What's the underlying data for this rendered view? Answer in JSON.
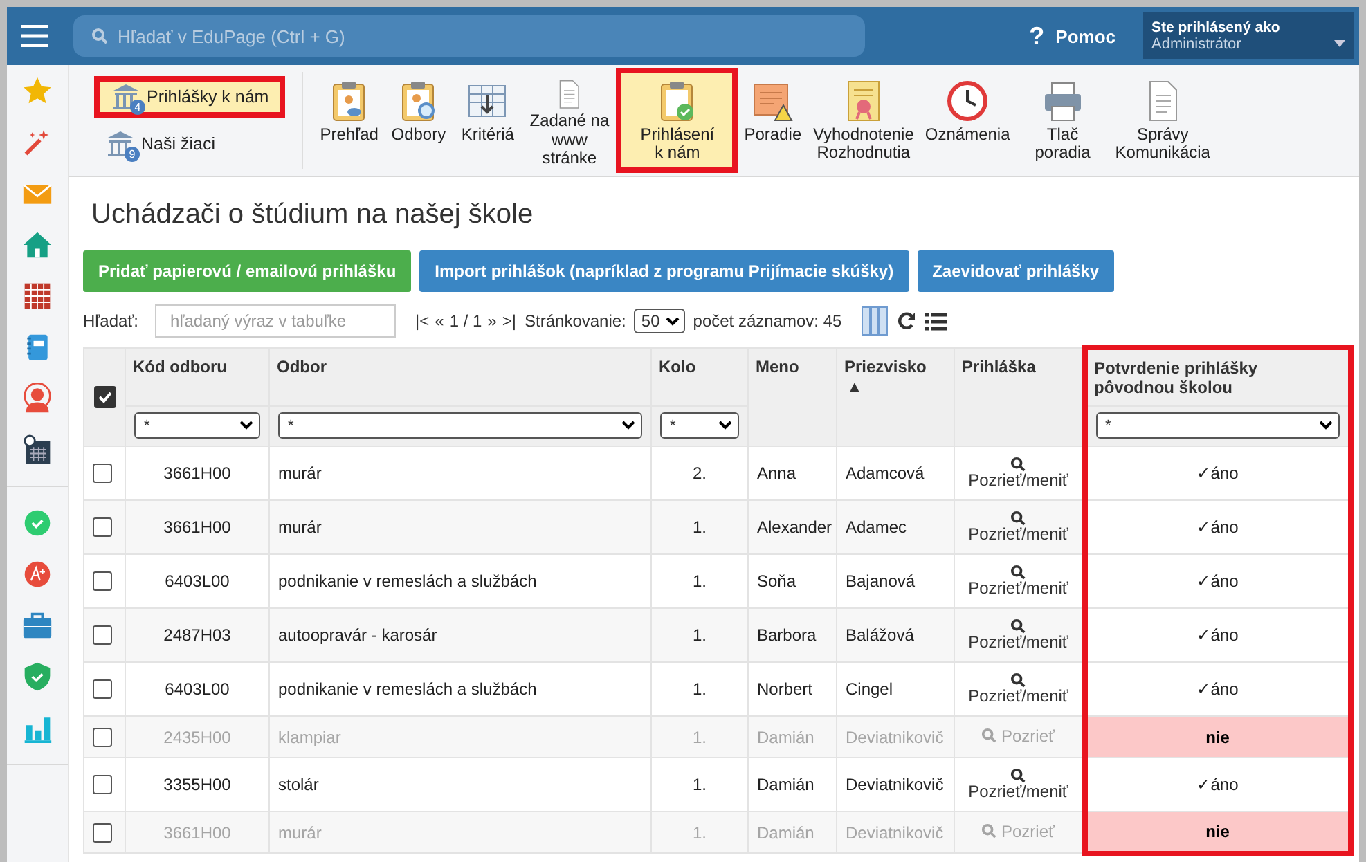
{
  "topbar": {
    "search": {
      "placeholder": "Hľadať v EduPage (Ctrl + G)"
    },
    "help": {
      "icon": "?",
      "label": "Pomoc"
    },
    "user": {
      "caption": "Ste prihlásený ako",
      "name": "Administrátor"
    }
  },
  "toolbar": {
    "left": [
      {
        "label": "Prihlášky k nám",
        "badge": "4",
        "selected": true,
        "highlighted": true
      },
      {
        "label": "Naši žiaci",
        "badge": "9",
        "selected": false,
        "highlighted": false
      }
    ],
    "tools": [
      {
        "label": "Prehľad",
        "selected": false,
        "highlighted": false
      },
      {
        "label": "Odbory",
        "selected": false,
        "highlighted": false
      },
      {
        "label": "Kritériá",
        "selected": false,
        "highlighted": false
      },
      {
        "label": "Zadané na www stránke",
        "selected": false,
        "highlighted": false
      },
      {
        "label": "Prihlásení k nám",
        "selected": true,
        "highlighted": true
      },
      {
        "label": "Poradie",
        "selected": false,
        "highlighted": false
      },
      {
        "label": "Vyhodnotenie Rozhodnutia",
        "selected": false,
        "highlighted": false
      },
      {
        "label": "Oznámenia",
        "selected": false,
        "highlighted": false
      },
      {
        "label": "Tlač poradia",
        "selected": false,
        "highlighted": false
      },
      {
        "label": "Správy Komunikácia",
        "selected": false,
        "highlighted": false
      }
    ]
  },
  "page_title": "Uchádzači o štúdium na našej škole",
  "actions": [
    {
      "label": "Pridať papierovú / emailovú prihlášku",
      "kind": "success"
    },
    {
      "label": "Import prihlášok (napríklad z programu Prijímacie skúšky)",
      "kind": "primary"
    },
    {
      "label": "Zaevidovať prihlášky",
      "kind": "primary"
    }
  ],
  "filterbar": {
    "search_label": "Hľadať:",
    "search_placeholder": "hľadaný výraz v tabuľke",
    "first": "|<",
    "prev": "«",
    "pages": "1 / 1",
    "next": "»",
    "last": ">|",
    "paging_label": "Stránkovanie:",
    "paging_value": "50",
    "count": "počet záznamov: 45"
  },
  "table": {
    "select_all_checked": true,
    "columns": [
      {
        "label": "Kód odboru",
        "filter": "*",
        "highlighted": false
      },
      {
        "label": "Odbor",
        "filter": "*",
        "highlighted": false
      },
      {
        "label": "Kolo",
        "filter": "*",
        "highlighted": false
      },
      {
        "label": "Meno",
        "highlighted": false
      },
      {
        "label": "Priezvisko",
        "sort": "▲",
        "highlighted": false
      },
      {
        "label": "Prihláška",
        "highlighted": false
      },
      {
        "label": "Potvrdenie prihlášky pôvodnou školou",
        "filter": "*",
        "highlighted": true
      }
    ],
    "rows": [
      {
        "checked": false,
        "disabled": false,
        "code": "3661H00",
        "field": "murár",
        "round": "2.",
        "first": "Anna",
        "last": "Adamcová",
        "link": "Pozrieť/meniť",
        "confirmed": true,
        "mark": "✓",
        "confirmation": "áno"
      },
      {
        "checked": false,
        "disabled": false,
        "code": "3661H00",
        "field": "murár",
        "round": "1.",
        "first": "Alexander",
        "last": "Adamec",
        "link": "Pozrieť/meniť",
        "confirmed": true,
        "mark": "✓",
        "confirmation": "áno"
      },
      {
        "checked": false,
        "disabled": false,
        "code": "6403L00",
        "field": "podnikanie v remeslách a službách",
        "round": "1.",
        "first": "Soňa",
        "last": "Bajanová",
        "link": "Pozrieť/meniť",
        "confirmed": true,
        "mark": "✓",
        "confirmation": "áno"
      },
      {
        "checked": false,
        "disabled": false,
        "code": "2487H03",
        "field": "autoopravár - karosár",
        "round": "1.",
        "first": "Barbora",
        "last": "Balážová",
        "link": "Pozrieť/meniť",
        "confirmed": true,
        "mark": "✓",
        "confirmation": "áno"
      },
      {
        "checked": false,
        "disabled": false,
        "code": "6403L00",
        "field": "podnikanie v remeslách a službách",
        "round": "1.",
        "first": "Norbert",
        "last": "Cingel",
        "link": "Pozrieť/meniť",
        "confirmed": true,
        "mark": "✓",
        "confirmation": "áno"
      },
      {
        "checked": false,
        "disabled": true,
        "code": "2435H00",
        "field": "klampiar",
        "round": "1.",
        "first": "Damián",
        "last": "Deviatnikovič",
        "link": "Pozrieť",
        "confirmed": false,
        "confirmation": "nie"
      },
      {
        "checked": false,
        "disabled": false,
        "code": "3355H00",
        "field": "stolár",
        "round": "1.",
        "first": "Damián",
        "last": "Deviatnikovič",
        "link": "Pozrieť/meniť",
        "confirmed": true,
        "mark": "✓",
        "confirmation": "áno"
      },
      {
        "checked": false,
        "disabled": true,
        "code": "3661H00",
        "field": "murár",
        "round": "1.",
        "first": "Damián",
        "last": "Deviatnikovič",
        "link": "Pozrieť",
        "confirmed": false,
        "confirmation": "nie"
      }
    ]
  }
}
